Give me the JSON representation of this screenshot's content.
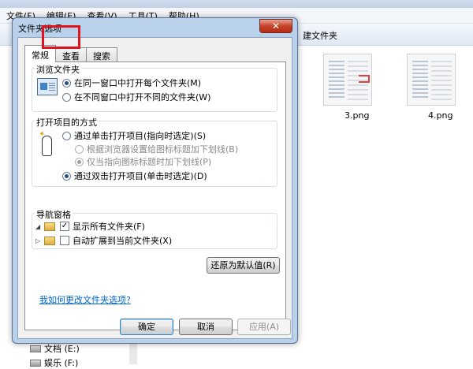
{
  "explorer": {
    "menu": [
      "文件(F)",
      "编辑(E)",
      "查看(V)",
      "工具(T)",
      "帮助(H)"
    ],
    "new_folder_label": "建文件夹",
    "files": [
      {
        "name": "3.png"
      },
      {
        "name": "4.png"
      }
    ],
    "nav_items": [
      "文档 (E:)",
      "娱乐 (F:)"
    ]
  },
  "dialog": {
    "title": "文件夹选项",
    "close_label": "✕",
    "tabs": [
      {
        "label": "常规",
        "active": true
      },
      {
        "label": "查看",
        "active": false,
        "highlighted": true
      },
      {
        "label": "搜索",
        "active": false
      }
    ],
    "browse_group": {
      "title": "浏览文件夹",
      "options": [
        {
          "label": "在同一窗口中打开每个文件夹(M)",
          "selected": true
        },
        {
          "label": "在不同窗口中打开不同的文件夹(W)",
          "selected": false
        }
      ]
    },
    "click_group": {
      "title": "打开项目的方式",
      "options": [
        {
          "label": "通过单击打开项目(指向时选定)(S)",
          "selected": false,
          "enabled": true
        },
        {
          "label": "根据浏览器设置给图标标题加下划线(B)",
          "selected": false,
          "enabled": false
        },
        {
          "label": "仅当指向图标标题时加下划线(P)",
          "selected": true,
          "enabled": false
        },
        {
          "label": "通过双击打开项目(单击时选定)(D)",
          "selected": true,
          "enabled": true
        }
      ]
    },
    "nav_group": {
      "title": "导航窗格",
      "options": [
        {
          "label": "显示所有文件夹(F)",
          "checked": true
        },
        {
          "label": "自动扩展到当前文件夹(X)",
          "checked": false
        }
      ]
    },
    "restore_defaults_label": "还原为默认值(R)",
    "help_link": "我如何更改文件夹选项?",
    "ok_label": "确定",
    "cancel_label": "取消",
    "apply_label": "应用(A)"
  },
  "colors": {
    "highlight_box": "#e0141e",
    "link": "#0066cc",
    "dialog_frame": "#b9d1ea"
  }
}
